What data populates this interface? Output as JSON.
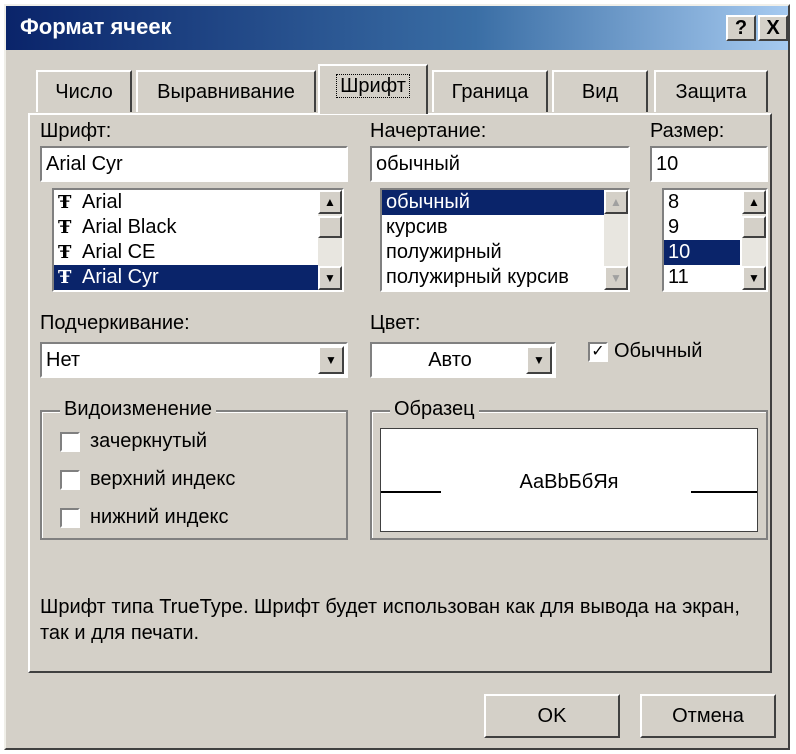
{
  "window": {
    "title": "Формат ячеек",
    "help_glyph": "?",
    "close_glyph": "X"
  },
  "tabs": [
    {
      "label": "Число",
      "active": false
    },
    {
      "label": "Выравнивание",
      "active": false
    },
    {
      "label": "Шрифт",
      "active": true
    },
    {
      "label": "Граница",
      "active": false
    },
    {
      "label": "Вид",
      "active": false
    },
    {
      "label": "Защита",
      "active": false
    }
  ],
  "font": {
    "label": "Шрифт:",
    "value": "Arial Cyr",
    "items": [
      "Arial",
      "Arial Black",
      "Arial CE",
      "Arial Cyr"
    ],
    "selected": "Arial Cyr",
    "icon": "truetype-icon"
  },
  "style": {
    "label": "Начертание:",
    "value": "обычный",
    "items": [
      "обычный",
      "курсив",
      "полужирный",
      "полужирный курсив"
    ],
    "selected": "обычный"
  },
  "size": {
    "label": "Размер:",
    "value": "10",
    "items": [
      "8",
      "9",
      "10",
      "11"
    ],
    "selected": "10"
  },
  "underline": {
    "label": "Подчеркивание:",
    "value": "Нет"
  },
  "color": {
    "label": "Цвет:",
    "value": "Авто"
  },
  "normal_font": {
    "label": "Обычный",
    "checked": true
  },
  "effects": {
    "label": "Видоизменение",
    "items": [
      {
        "label": "зачеркнутый",
        "checked": false
      },
      {
        "label": "верхний индекс",
        "checked": false
      },
      {
        "label": "нижний индекс",
        "checked": false
      }
    ]
  },
  "preview": {
    "label": "Образец",
    "sample": "АаBbБбЯя"
  },
  "info_text": "Шрифт типа TrueType. Шрифт будет использован как для вывода на экран, так и для печати.",
  "buttons": {
    "ok": "OK",
    "cancel": "Отмена"
  },
  "colors": {
    "title_start": "#0a246a",
    "title_end": "#a6caf0",
    "face": "#d4d0c8",
    "selection": "#0a246a"
  }
}
